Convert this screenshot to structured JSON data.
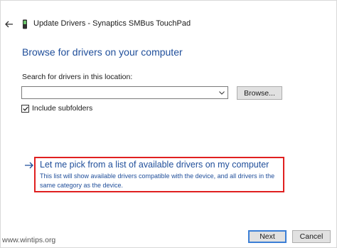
{
  "window": {
    "title": "Update Drivers - Synaptics SMBus TouchPad"
  },
  "main": {
    "heading": "Browse for drivers on your computer",
    "search_label": "Search for drivers in this location:",
    "search_value": "",
    "browse_label": "Browse...",
    "include_subfolders": {
      "label": "Include subfolders",
      "checked": true
    },
    "pick_option": {
      "title": "Let me pick from a list of available drivers on my computer",
      "description": "This list will show available drivers compatible with the device, and all drivers in the same category as the device."
    }
  },
  "footer": {
    "watermark": "www.wintips.org",
    "next_label": "Next",
    "cancel_label": "Cancel"
  },
  "icons": {
    "back": "back-arrow-icon",
    "device": "touchpad-device-icon",
    "dropdown": "chevron-down-icon",
    "checkbox": "checkmark-icon",
    "pick_arrow": "right-arrow-icon"
  },
  "colors": {
    "link_blue": "#1f4e9a",
    "highlight_red": "#e02020",
    "default_button_border": "#3c7fd6"
  }
}
